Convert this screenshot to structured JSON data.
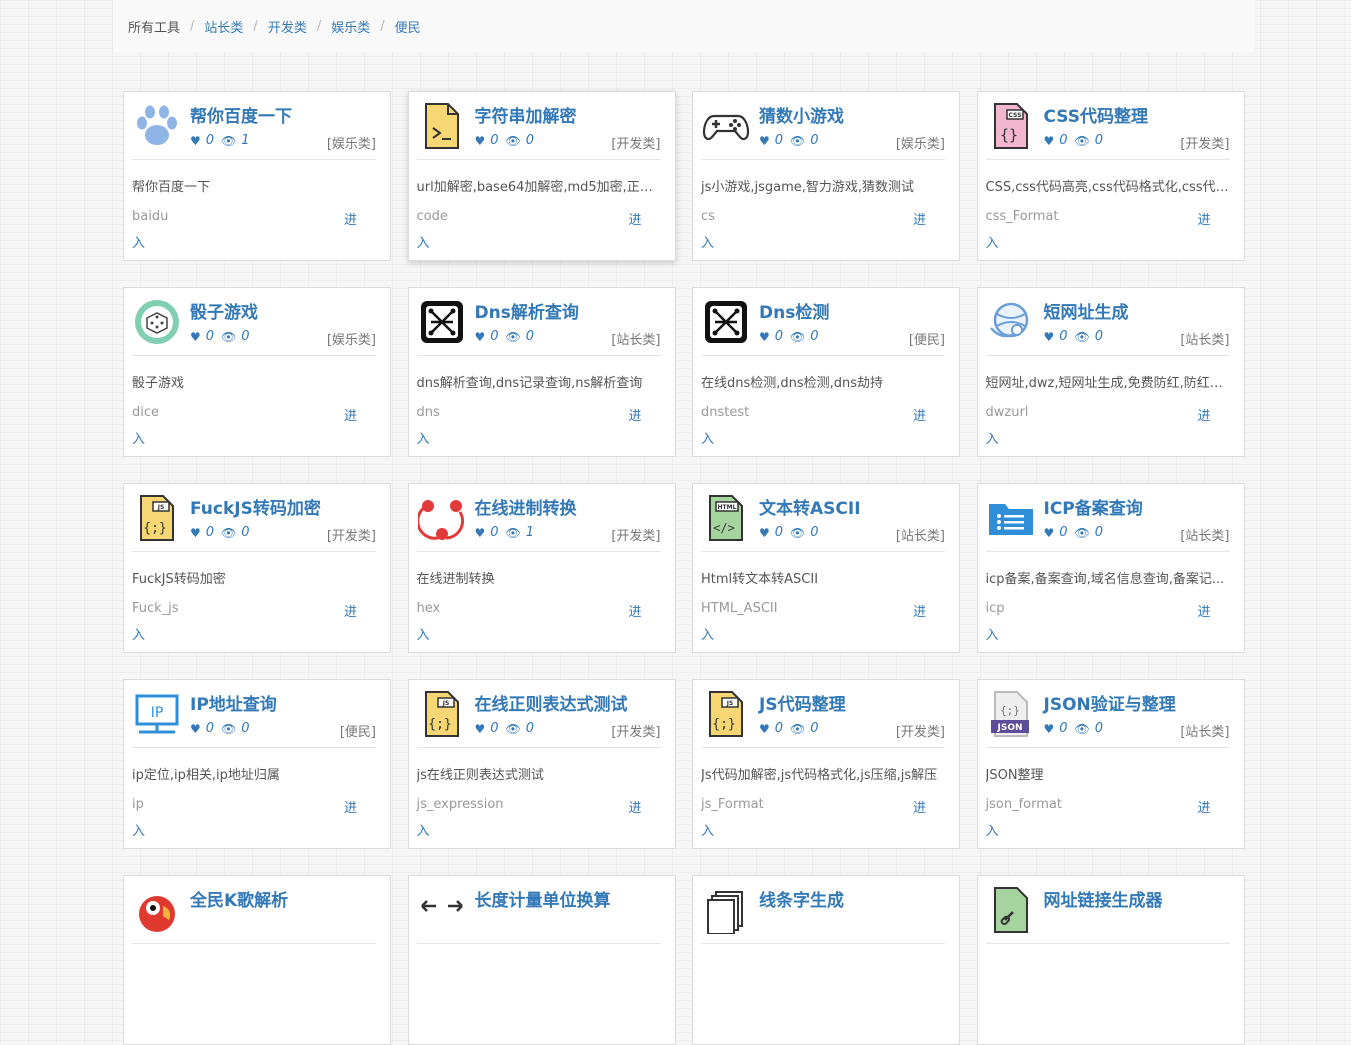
{
  "breadcrumb": [
    "所有工具",
    "站长类",
    "开发类",
    "娱乐类",
    "便民"
  ],
  "accent_color": "#3379b7",
  "enter_text_1": "进",
  "enter_text_2": "入",
  "cards": [
    {
      "title": "帮你百度一下",
      "likes": "0",
      "views": "1",
      "category": "[娱乐类]",
      "desc": "帮你百度一下",
      "slug": "baidu",
      "icon": "paw-icon"
    },
    {
      "title": "字符串加解密",
      "likes": "0",
      "views": "0",
      "category": "[开发类]",
      "desc": "url加解密,base64加解密,md5加密,正则...",
      "slug": "code",
      "icon": "terminal-file-icon"
    },
    {
      "title": "猜数小游戏",
      "likes": "0",
      "views": "0",
      "category": "[娱乐类]",
      "desc": "js小游戏,jsgame,智力游戏,猜数测试",
      "slug": "cs",
      "icon": "gamepad-icon"
    },
    {
      "title": "CSS代码整理",
      "likes": "0",
      "views": "0",
      "category": "[开发类]",
      "desc": "CSS,css代码高亮,css代码格式化,css代码...",
      "slug": "css_Format",
      "icon": "css-file-icon"
    },
    {
      "title": "骰子游戏",
      "likes": "0",
      "views": "0",
      "category": "[娱乐类]",
      "desc": "骰子游戏",
      "slug": "dice",
      "icon": "dice-icon"
    },
    {
      "title": "Dns解析查询",
      "likes": "0",
      "views": "0",
      "category": "[站长类]",
      "desc": "dns解析查询,dns记录查询,ns解析查询",
      "slug": "dns",
      "icon": "network-icon"
    },
    {
      "title": "Dns检测",
      "likes": "0",
      "views": "0",
      "category": "[便民]",
      "desc": "在线dns检测,dns检测,dns劫持",
      "slug": "dnstest",
      "icon": "network-icon"
    },
    {
      "title": "短网址生成",
      "likes": "0",
      "views": "0",
      "category": "[站长类]",
      "desc": "短网址,dwz,短网址生成,免费防红,防红接...",
      "slug": "dwzurl",
      "icon": "globe-link-icon"
    },
    {
      "title": "FuckJS转码加密",
      "likes": "0",
      "views": "0",
      "category": "[开发类]",
      "desc": "FuckJS转码加密",
      "slug": "Fuck_js",
      "icon": "js-file-icon"
    },
    {
      "title": "在线进制转换",
      "likes": "0",
      "views": "1",
      "category": "[开发类]",
      "desc": "在线进制转换",
      "slug": "hex",
      "icon": "share-circle-icon"
    },
    {
      "title": "文本转ASCII",
      "likes": "0",
      "views": "0",
      "category": "[站长类]",
      "desc": "Html转文本转ASCII",
      "slug": "HTML_ASCII",
      "icon": "html-file-icon"
    },
    {
      "title": "ICP备案查询",
      "likes": "0",
      "views": "0",
      "category": "[站长类]",
      "desc": "icp备案,备案查询,域名信息查询,备案记...",
      "slug": "icp",
      "icon": "folder-list-icon"
    },
    {
      "title": "IP地址查询",
      "likes": "0",
      "views": "0",
      "category": "[便民]",
      "desc": "ip定位,ip相关,ip地址归属",
      "slug": "ip",
      "icon": "ip-monitor-icon"
    },
    {
      "title": "在线正则表达式测试",
      "likes": "0",
      "views": "0",
      "category": "[开发类]",
      "desc": "js在线正则表达式测试",
      "slug": "js_expression",
      "icon": "js-file-icon"
    },
    {
      "title": "JS代码整理",
      "likes": "0",
      "views": "0",
      "category": "[开发类]",
      "desc": "Js代码加解密,js代码格式化,js压缩,js解压",
      "slug": "js_Format",
      "icon": "js-file-icon"
    },
    {
      "title": "JSON验证与整理",
      "likes": "0",
      "views": "0",
      "category": "[站长类]",
      "desc": "JSON整理",
      "slug": "json_format",
      "icon": "json-file-icon"
    },
    {
      "title": "全民K歌解析",
      "likes": "",
      "views": "",
      "category": "",
      "desc": "",
      "slug": "",
      "icon": "parrot-icon"
    },
    {
      "title": "长度计量单位换算",
      "likes": "",
      "views": "",
      "category": "",
      "desc": "",
      "slug": "",
      "icon": "arrows-icon"
    },
    {
      "title": "线条字生成",
      "likes": "",
      "views": "",
      "category": "",
      "desc": "",
      "slug": "",
      "icon": "stack-icon"
    },
    {
      "title": "网址链接生成器",
      "likes": "",
      "views": "",
      "category": "",
      "desc": "",
      "slug": "",
      "icon": "link-file-icon"
    }
  ]
}
